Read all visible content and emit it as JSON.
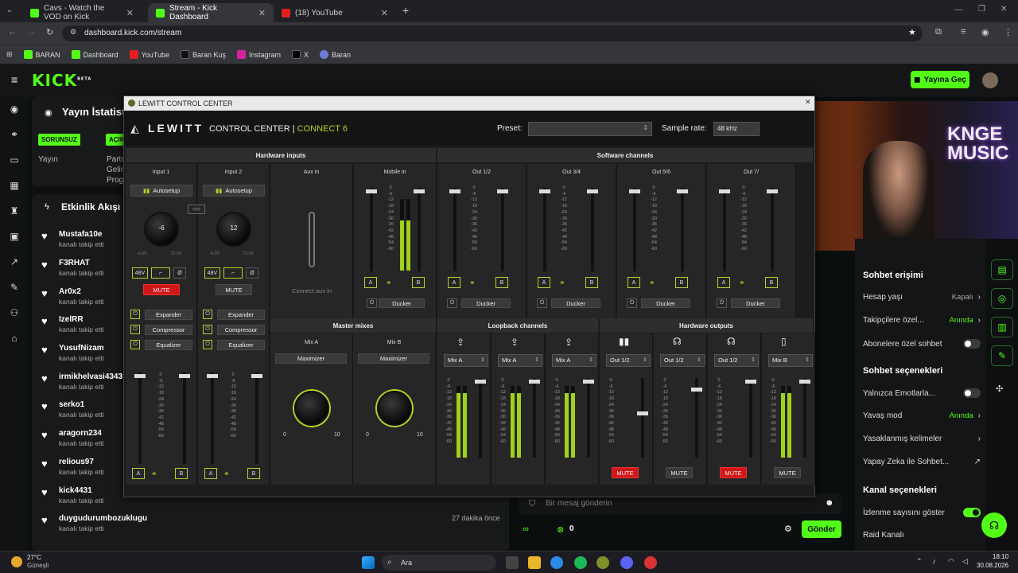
{
  "browser": {
    "tabs": [
      {
        "title": "Cavs - Watch the VOD on Kick",
        "active": false
      },
      {
        "title": "Stream - Kick Dashboard",
        "active": true
      },
      {
        "title": "(18) YouTube",
        "active": false
      }
    ],
    "url": "dashboard.kick.com/stream",
    "bookmarks": [
      "BARAN",
      "Dashboard",
      "YouTube",
      "Baran Kuş",
      "Instagram",
      "X",
      "Baran"
    ]
  },
  "kick": {
    "logo": "KICK",
    "beta": "BETA",
    "go_live": "Yayına Geç",
    "stats_title": "Yayın İstatist",
    "issues_badge": "SORUNSUZ",
    "ac_badge": "AÇIK",
    "yayin": "Yayın",
    "partner_lines": [
      "Partn",
      "Gelir",
      "Prog"
    ],
    "feed_title": "Etkinlik Akışı",
    "feed": [
      {
        "name": "Mustafa10e",
        "sub": "kanalı takip etti"
      },
      {
        "name": "F3RHAT",
        "sub": "kanalı takip etti"
      },
      {
        "name": "Ar0x2",
        "sub": "kanalı takip etti"
      },
      {
        "name": "IzelRR",
        "sub": "kanalı takip etti"
      },
      {
        "name": "YusufNizam",
        "sub": "kanalı takip etti"
      },
      {
        "name": "irmikhelvasi4343",
        "sub": "kanalı takip etti"
      },
      {
        "name": "serko1",
        "sub": "kanalı takip etti"
      },
      {
        "name": "aragorn234",
        "sub": "kanalı takip etti"
      },
      {
        "name": "relious97",
        "sub": "kanalı takip etti"
      },
      {
        "name": "kick4431",
        "sub": "kanalı takip etti"
      },
      {
        "name": "duygudurumbozuklugu",
        "sub": "kanalı takip etti",
        "time": "27 dakika önce"
      }
    ],
    "chat_placeholder": "Bir mesaj gönderin",
    "viewer_count": "0",
    "send": "Gönder",
    "settings": {
      "chat_access": "Sohbet erişimi",
      "account_age": "Hesap yaşı",
      "account_age_val": "Kapalı",
      "followers_only": "Takipçilere özel...",
      "followers_only_val": "Anında",
      "subs_only": "Abonelere özel sohbet",
      "chat_options": "Sohbet seçenekleri",
      "emotes_only": "Yalnızca Emotlarla...",
      "slow_mode": "Yavaş mod",
      "slow_mode_val": "Anında",
      "banned_words": "Yasaklanmış kelimeler",
      "ai": "Yapay Zeka ile Sohbet...",
      "channel_options": "Kanal seçenekleri",
      "show_viewers": "İzlenme sayısını göster",
      "raid": "Raid Kanalı"
    }
  },
  "lewitt": {
    "window_title": "LEWITT CONTROL CENTER",
    "brand": "LEWITT",
    "app": "CONTROL CENTER",
    "sep": "|",
    "device": "CONNECT 6",
    "preset_label": "Preset:",
    "sample_label": "Sample rate:",
    "sample_val": "48 kHz",
    "sections": {
      "hw_in": "Hardware inputs",
      "sw": "Software channels",
      "master": "Master mixes",
      "loop": "Loopback channels",
      "hw_out": "Hardware outputs"
    },
    "inputs": [
      {
        "name": "Input 1",
        "autosetup": "Autosetup",
        "gain": "-6",
        "min": "-6.00",
        "max": "72.00",
        "mute": "MUTE"
      },
      {
        "name": "Input 2",
        "autosetup": "Autosetup",
        "gain": "12",
        "min": "-6.00",
        "max": "72.00",
        "mute": "MUTE"
      }
    ],
    "aux": {
      "name": "Aux in",
      "connect": "Connect aux in"
    },
    "mobile": "Mobile in",
    "p48": "48V",
    "phase": "Ø",
    "outs": [
      "Out 1/2",
      "Out 3/4",
      "Out 5/6",
      "Out 7/"
    ],
    "ducker": "Ducker",
    "dyn": [
      "Expander",
      "Compressor",
      "Equalizer"
    ],
    "mixes": [
      {
        "name": "Mix A",
        "btn": "Maximizer"
      },
      {
        "name": "Mix B",
        "btn": "Maximizer"
      }
    ],
    "knob_min": "0",
    "knob_max": "10",
    "loop_sel": [
      "Mix A",
      "Mix A",
      "Mix A"
    ],
    "hw_out_sel": [
      "Out 1/2",
      "Out 1/2",
      "Out 1/2",
      "Mix B"
    ],
    "out_mutes": [
      {
        "label": "MUTE",
        "on": true
      },
      {
        "label": "MUTE",
        "on": false
      },
      {
        "label": "MUTE",
        "on": true
      },
      {
        "label": "MUTE",
        "on": false
      }
    ],
    "scale": [
      "0",
      "-6",
      "-12",
      "-18",
      "-24",
      "-30",
      "-36",
      "-42",
      "-48",
      "-54",
      "-60"
    ],
    "ab": [
      "A",
      "B"
    ]
  },
  "taskbar": {
    "temp": "27°C",
    "weather": "Güneşli",
    "search": "Ara",
    "time": "18:10",
    "date": "30.08.2026"
  }
}
